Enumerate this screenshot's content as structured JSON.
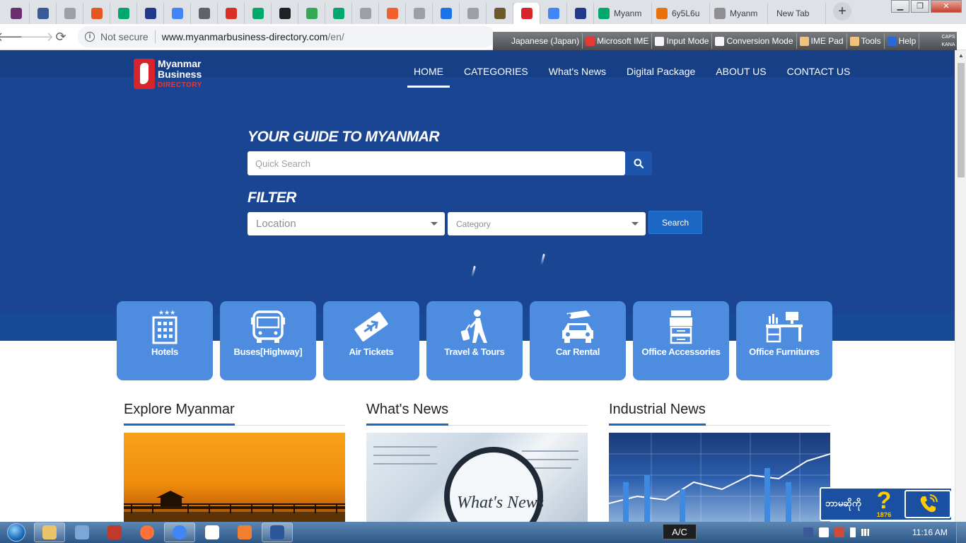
{
  "browser": {
    "tabs": [
      {
        "favicon": "slack-icon",
        "color": "#6b2e6e",
        "title": ""
      },
      {
        "favicon": "facebook-icon",
        "color": "#3b5998",
        "title": ""
      },
      {
        "favicon": "document-icon",
        "color": "#9aa0a6",
        "title": ""
      },
      {
        "favicon": "slides-icon",
        "color": "#e8561f",
        "title": ""
      },
      {
        "favicon": "play-icon",
        "color": "#00a86b",
        "title": ""
      },
      {
        "favicon": "tp-icon",
        "color": "#1f3a8a",
        "title": ""
      },
      {
        "favicon": "translate-icon",
        "color": "#4285f4",
        "title": ""
      },
      {
        "favicon": "mail-icon",
        "color": "#5f6368",
        "title": ""
      },
      {
        "favicon": "gmail-icon",
        "color": "#d93025",
        "title": ""
      },
      {
        "favicon": "play-icon",
        "color": "#00a86b",
        "title": ""
      },
      {
        "favicon": "medium-icon",
        "color": "#202124",
        "title": ""
      },
      {
        "favicon": "maps-icon",
        "color": "#34a853",
        "title": ""
      },
      {
        "favicon": "play-icon",
        "color": "#00a86b",
        "title": ""
      },
      {
        "favicon": "document-icon",
        "color": "#9aa0a6",
        "title": ""
      },
      {
        "favicon": "b-icon",
        "color": "#f0612d",
        "title": ""
      },
      {
        "favicon": "document-icon",
        "color": "#9aa0a6",
        "title": ""
      },
      {
        "favicon": "swoosh-icon",
        "color": "#1a73e8",
        "title": ""
      },
      {
        "favicon": "document-icon",
        "color": "#9aa0a6",
        "title": ""
      },
      {
        "favicon": "globe-icon",
        "color": "#6d5a2a",
        "title": ""
      },
      {
        "favicon": "myanmar-directory-icon",
        "color": "#d8232a",
        "title": "",
        "active": true
      },
      {
        "favicon": "google-icon",
        "color": "#4285f4",
        "title": ""
      },
      {
        "favicon": "tp-icon",
        "color": "#1f3a8a",
        "title": ""
      },
      {
        "favicon": "play-icon",
        "color": "#00a86b",
        "title": "Myanm"
      },
      {
        "favicon": "pinwheel-icon",
        "color": "#e8710a",
        "title": "6y5L6u"
      },
      {
        "favicon": "apple-icon",
        "color": "#8e8e93",
        "title": "Myanm"
      },
      {
        "favicon": "",
        "color": "",
        "title": "New Tab"
      }
    ],
    "address": {
      "security_label": "Not secure",
      "url_host": "www.myanmarbusiness-directory.com",
      "url_path": "/en/"
    }
  },
  "ime": {
    "items": [
      {
        "icon": "jp-icon",
        "label": "Japanese (Japan)"
      },
      {
        "icon": "microsoft-ime-icon",
        "label": "Microsoft IME"
      },
      {
        "icon": "input-mode-icon",
        "label": "Input Mode"
      },
      {
        "icon": "conversion-mode-icon",
        "label": "Conversion Mode"
      },
      {
        "icon": "ime-pad-icon",
        "label": "IME Pad"
      },
      {
        "icon": "tools-icon",
        "label": "Tools"
      },
      {
        "icon": "help-icon",
        "label": "Help"
      }
    ],
    "indicator_top": "CAPS",
    "indicator_bottom": "KANA"
  },
  "site": {
    "logo": {
      "line1": "Myanmar",
      "line2": "Business",
      "line3": "DIRECTORY"
    },
    "nav": [
      "HOME",
      "CATEGORIES",
      "What's News",
      "Digital Package",
      "ABOUT US",
      "CONTACT US"
    ],
    "active_nav": "HOME",
    "hero": {
      "guide_title": "YOUR GUIDE TO MYANMAR",
      "quick_search_placeholder": "Quick Search",
      "filter_title": "FILTER",
      "location_placeholder": "Location",
      "category_placeholder": "Category",
      "search_label": "Search"
    },
    "categories": [
      {
        "label": "Hotels",
        "icon": "hotel-icon"
      },
      {
        "label": "Buses[Highway]",
        "icon": "bus-icon"
      },
      {
        "label": "Air Tickets",
        "icon": "plane-ticket-icon"
      },
      {
        "label": "Travel & Tours",
        "icon": "traveler-icon"
      },
      {
        "label": "Car Rental",
        "icon": "car-key-icon"
      },
      {
        "label": "Office Accessories",
        "icon": "printer-icon"
      },
      {
        "label": "Office Furnitures",
        "icon": "desk-icon"
      }
    ],
    "sections": [
      {
        "title": "Explore Myanmar"
      },
      {
        "title": "What's News"
      },
      {
        "title": "Industrial News"
      }
    ],
    "support": {
      "text": "ဘာမဆိုကို",
      "number": "18?6",
      "phone_icon": "phone-icon"
    }
  },
  "taskbar": {
    "items": [
      "folder-icon",
      "rss-icon",
      "network-icon",
      "firefox-icon",
      "chrome-icon",
      "notes-icon",
      "app-icon",
      "word-icon"
    ],
    "ac_label": "A/C",
    "clock": "11:16 AM"
  },
  "colors": {
    "hero_bg": "#1a4592",
    "card_bg": "#4d8cdf",
    "accent": "#1d67c4"
  }
}
